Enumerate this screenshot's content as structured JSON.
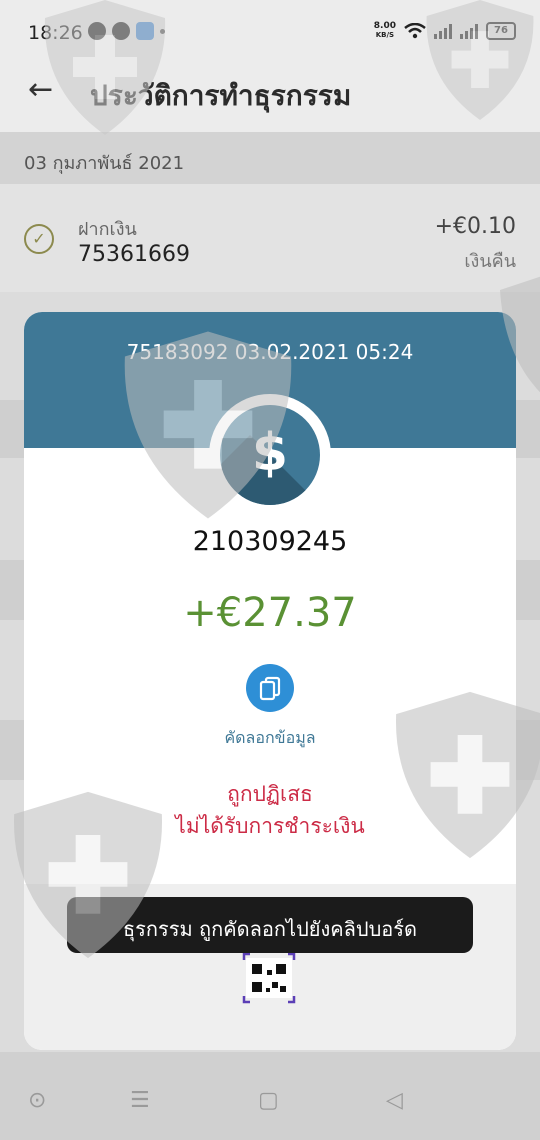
{
  "status_bar": {
    "time": "18:26",
    "net_speed_value": "8.00",
    "net_speed_unit": "KB/S",
    "battery": "76"
  },
  "header": {
    "back_icon": "arrow-left-icon",
    "title": "ประวัติการทำธุรกรรม"
  },
  "list": {
    "date": "03 กุมภาพันธ์ 2021",
    "transaction": {
      "type": "ฝากเงิน",
      "id": "75361669",
      "amount": "+€0.10",
      "note": "เงินคืน"
    }
  },
  "modal": {
    "header_text": "75183092 03.02.2021 05:24",
    "icon": "dollar-coin-icon",
    "receipt_number": "210309245",
    "amount": "+€27.37",
    "copy_label": "คัดลอกข้อมูล",
    "status_line1": "ถูกปฏิเสธ",
    "status_line2": "ไม่ได้รับการชำระเงิน",
    "qr_icon": "qr-code-icon"
  },
  "toast": {
    "text": "ธุรกรรม ถูกคัดลอกไปยังคลิปบอร์ด"
  },
  "colors": {
    "modal_header": "#3f7896",
    "amount_green": "#5a9134",
    "status_red": "#cc2b46",
    "copy_blue": "#2e8fd6"
  }
}
